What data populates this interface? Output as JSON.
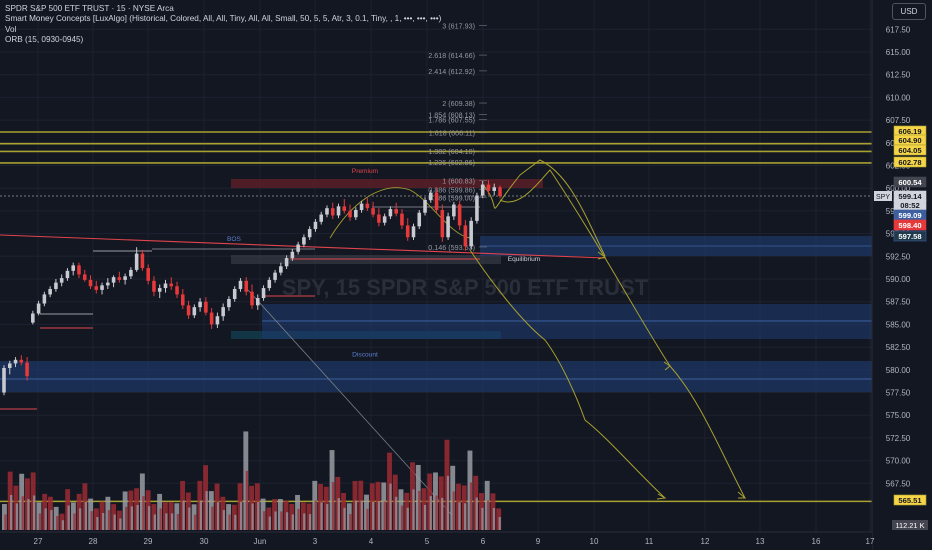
{
  "header": {
    "title": "SPDR S&P 500 ETF TRUST · 15 · NYSE Arca",
    "indicators": [
      "Smart Money Concepts [LuxAlgo] (Historical, Colored, All, All, Tiny, All, All, Small, 50, 5, 5, Atr, 3, 0.1, Tiny, , 1, •••, •••, •••)",
      "Vol",
      "ORB (15, 0930-0945)"
    ],
    "currency_button": "USD"
  },
  "colors": {
    "background": "#131722",
    "grid": "#1e2230",
    "candle_up": "#c8cad1",
    "candle_down": "#e6393a",
    "olive": "#a8a030",
    "zone_blue": "#1e3a6e",
    "red_line": "#e0444c",
    "volume_down": "#9c2a32",
    "volume_up": "#9a9ca2"
  },
  "chart_data": {
    "type": "candlestick",
    "symbol": "SPY",
    "watermark": "SPY, 15 SPDR S&P 500 ETF TRUST",
    "y_axis": {
      "range": [
        565.0,
        619.0
      ],
      "ticks": [
        617.5,
        615.0,
        612.5,
        610.0,
        607.5,
        605.0,
        602.5,
        600.0,
        597.5,
        595.0,
        592.5,
        590.0,
        587.5,
        585.0,
        582.5,
        580.0,
        577.5,
        575.0,
        572.5,
        570.0,
        567.5
      ],
      "tick_labels": [
        "617.50",
        "615.00",
        "612.50",
        "610.00",
        "607.50",
        "605.00",
        "602.50",
        "600.00",
        "597.50",
        "595.00",
        "592.50",
        "590.00",
        "587.50",
        "585.00",
        "582.50",
        "580.00",
        "577.50",
        "575.00",
        "572.50",
        "570.00",
        "567.50"
      ]
    },
    "x_axis": {
      "labels": [
        "27",
        "28",
        "29",
        "30",
        "Jun",
        "3",
        "4",
        "5",
        "6",
        "9",
        "10",
        "11",
        "12",
        "13",
        "16",
        "17"
      ]
    },
    "price_badges": [
      {
        "label": "606.19",
        "value": 606.19,
        "style": "olive"
      },
      {
        "label": "604.90",
        "value": 604.9,
        "style": "olive"
      },
      {
        "label": "604.05",
        "value": 604.05,
        "style": "olive"
      },
      {
        "label": "602.78",
        "value": 602.78,
        "style": "olive"
      },
      {
        "label": "600.54",
        "value": 600.54,
        "style": "grey"
      },
      {
        "label": "599.14",
        "value": 599.14,
        "style": "current"
      },
      {
        "label": "08:52",
        "value": 598.4,
        "style": "time"
      },
      {
        "label": "599.09",
        "value": 597.2,
        "style": "blue"
      },
      {
        "label": "598.40",
        "value": 596.5,
        "style": "red"
      },
      {
        "label": "597.58",
        "value": 595.7,
        "style": "dark"
      },
      {
        "label": "565.51",
        "value": 565.51,
        "style": "olive"
      }
    ],
    "symbol_tag": "SPY",
    "volume_badge": "112.21 K",
    "fib_levels": [
      {
        "label": "3 (617.93)",
        "value": 617.93
      },
      {
        "label": "2.618 (614.66)",
        "value": 614.66
      },
      {
        "label": "2.414 (612.92)",
        "value": 612.92
      },
      {
        "label": "2 (609.38)",
        "value": 609.38
      },
      {
        "label": "1.854 (608.13)",
        "value": 608.13
      },
      {
        "label": "1.786 (607.55)",
        "value": 607.55
      },
      {
        "label": "1.618 (606.11)",
        "value": 606.11
      },
      {
        "label": "1.382 (604.10)",
        "value": 604.1
      },
      {
        "label": "1.236 (602.86)",
        "value": 602.86
      },
      {
        "label": "1 (600.83)",
        "value": 600.83
      },
      {
        "label": "0.886 (599.86)",
        "value": 599.86
      },
      {
        "label": "0.786 (599.00)",
        "value": 599.0
      },
      {
        "label": "0.146 (593.53)",
        "value": 593.53
      }
    ],
    "annotations": [
      {
        "text": "Premium",
        "price": 602.0,
        "color": "#e0444c"
      },
      {
        "text": "Equilibrium",
        "price": 592.3,
        "color": "#d1d4dc"
      },
      {
        "text": "Discount",
        "price": 581.8,
        "color": "#5b7fcf"
      },
      {
        "text": "BOS",
        "price": 594.5,
        "color": "#5b7fcf"
      }
    ],
    "candles": [
      [
        577.5,
        580.5,
        577.2,
        580.2
      ],
      [
        580.2,
        581.0,
        579.5,
        580.7
      ],
      [
        580.7,
        581.4,
        580.3,
        581.1
      ],
      [
        581.1,
        581.6,
        580.5,
        580.8
      ],
      [
        580.8,
        581.4,
        578.8,
        579.3
      ],
      [
        585.2,
        586.5,
        585.0,
        586.2
      ],
      [
        586.2,
        587.6,
        586.0,
        587.3
      ],
      [
        587.3,
        588.6,
        587.0,
        588.3
      ],
      [
        588.3,
        589.2,
        588.0,
        588.9
      ],
      [
        588.9,
        590.0,
        588.6,
        589.6
      ],
      [
        589.6,
        590.5,
        589.2,
        590.1
      ],
      [
        590.1,
        591.2,
        589.8,
        590.9
      ],
      [
        590.9,
        591.8,
        590.4,
        591.5
      ],
      [
        591.5,
        591.8,
        590.1,
        590.5
      ],
      [
        590.5,
        591.0,
        589.7,
        589.9
      ],
      [
        589.9,
        590.4,
        588.9,
        589.2
      ],
      [
        589.2,
        589.8,
        588.4,
        588.8
      ],
      [
        588.8,
        589.6,
        588.3,
        589.3
      ],
      [
        589.3,
        590.1,
        588.9,
        589.6
      ],
      [
        589.6,
        590.4,
        589.1,
        590.2
      ],
      [
        590.2,
        590.8,
        589.6,
        589.9
      ],
      [
        589.9,
        590.6,
        589.4,
        590.3
      ],
      [
        590.3,
        591.3,
        590.0,
        591.0
      ],
      [
        591.0,
        593.5,
        590.8,
        592.8
      ],
      [
        592.8,
        593.2,
        590.9,
        591.2
      ],
      [
        591.2,
        591.6,
        589.4,
        589.8
      ],
      [
        589.8,
        590.3,
        588.1,
        588.6
      ],
      [
        588.6,
        589.4,
        587.9,
        589.0
      ],
      [
        589.0,
        589.9,
        588.5,
        589.5
      ],
      [
        589.5,
        590.2,
        588.8,
        589.2
      ],
      [
        589.2,
        589.7,
        587.9,
        588.3
      ],
      [
        588.3,
        588.9,
        586.7,
        587.1
      ],
      [
        587.1,
        587.6,
        585.6,
        586.0
      ],
      [
        586.0,
        587.2,
        585.7,
        586.9
      ],
      [
        586.9,
        587.9,
        586.4,
        587.5
      ],
      [
        587.5,
        588.0,
        586.0,
        586.3
      ],
      [
        586.3,
        586.8,
        584.5,
        585.0
      ],
      [
        585.0,
        586.3,
        584.6,
        585.9
      ],
      [
        585.9,
        587.3,
        585.4,
        586.9
      ],
      [
        586.9,
        588.1,
        586.5,
        587.8
      ],
      [
        587.8,
        589.2,
        587.5,
        588.9
      ],
      [
        588.9,
        590.1,
        588.6,
        589.8
      ],
      [
        589.8,
        590.2,
        588.2,
        588.6
      ],
      [
        588.6,
        589.4,
        586.7,
        587.1
      ],
      [
        587.1,
        588.3,
        586.6,
        587.9
      ],
      [
        587.9,
        589.3,
        587.6,
        589.0
      ],
      [
        589.0,
        590.2,
        588.7,
        589.9
      ],
      [
        589.9,
        591.0,
        589.6,
        590.7
      ],
      [
        590.7,
        591.8,
        590.4,
        591.4
      ],
      [
        591.4,
        592.6,
        591.1,
        592.3
      ],
      [
        592.3,
        593.3,
        592.0,
        593.0
      ],
      [
        593.0,
        594.1,
        592.7,
        593.8
      ],
      [
        593.8,
        594.9,
        593.5,
        594.6
      ],
      [
        594.6,
        595.8,
        594.3,
        595.5
      ],
      [
        595.5,
        596.6,
        595.2,
        596.3
      ],
      [
        596.3,
        597.4,
        596.0,
        597.1
      ],
      [
        597.1,
        598.1,
        596.8,
        597.8
      ],
      [
        597.8,
        598.4,
        596.6,
        597.0
      ],
      [
        597.0,
        598.3,
        596.7,
        598.0
      ],
      [
        598.0,
        598.8,
        597.2,
        597.5
      ],
      [
        597.5,
        598.2,
        596.4,
        596.8
      ],
      [
        596.8,
        597.9,
        596.5,
        597.6
      ],
      [
        597.6,
        598.6,
        597.3,
        598.3
      ],
      [
        598.3,
        598.9,
        597.5,
        597.8
      ],
      [
        597.8,
        598.5,
        596.8,
        597.1
      ],
      [
        597.1,
        597.8,
        595.8,
        596.2
      ],
      [
        596.2,
        597.2,
        595.9,
        596.9
      ],
      [
        596.9,
        598.0,
        596.6,
        597.7
      ],
      [
        597.7,
        598.4,
        596.9,
        597.2
      ],
      [
        597.2,
        597.7,
        595.5,
        595.9
      ],
      [
        595.9,
        596.7,
        594.2,
        594.6
      ],
      [
        594.6,
        596.1,
        594.3,
        595.8
      ],
      [
        595.8,
        597.6,
        595.5,
        597.3
      ],
      [
        597.3,
        599.0,
        597.0,
        598.7
      ],
      [
        598.7,
        599.8,
        598.4,
        599.5
      ],
      [
        599.5,
        600.0,
        597.2,
        597.6
      ],
      [
        597.6,
        598.2,
        594.1,
        594.6
      ],
      [
        594.6,
        597.3,
        594.3,
        596.9
      ],
      [
        596.9,
        598.5,
        596.5,
        598.2
      ],
      [
        598.2,
        598.6,
        595.4,
        595.9
      ],
      [
        595.9,
        596.5,
        593.1,
        593.6
      ],
      [
        593.6,
        596.8,
        593.3,
        596.4
      ],
      [
        596.4,
        599.5,
        596.1,
        599.2
      ],
      [
        599.2,
        600.8,
        598.9,
        600.4
      ],
      [
        600.4,
        600.9,
        599.3,
        599.7
      ],
      [
        599.7,
        600.5,
        599.2,
        600.1
      ],
      [
        600.1,
        600.3,
        598.9,
        599.14
      ]
    ],
    "volume": [
      0.35,
      0.5,
      0.45,
      0.7,
      0.42,
      0.55,
      0.32,
      0.28,
      0.3,
      0.25,
      0.22,
      0.35,
      0.28,
      0.45,
      0.38,
      0.3,
      0.25,
      0.22,
      0.3,
      0.28,
      0.26,
      0.33,
      0.4,
      0.52,
      0.46,
      0.38,
      0.3,
      0.28,
      0.25,
      0.3,
      0.36,
      0.42,
      0.38,
      0.32,
      0.4,
      0.62,
      0.45,
      0.36,
      0.3,
      0.28,
      0.34,
      0.4,
      1.0,
      0.55,
      0.38,
      0.3,
      0.26,
      0.24,
      0.28,
      0.32,
      0.35,
      0.3,
      0.28,
      0.33,
      0.4,
      0.44,
      0.5,
      0.62,
      0.48,
      0.4,
      0.36,
      0.42,
      0.5,
      0.44,
      0.38,
      0.46,
      0.55,
      0.6,
      0.5,
      0.44,
      0.5,
      0.58,
      0.66,
      0.52,
      0.46,
      0.55,
      0.62,
      0.7,
      0.58,
      0.5,
      0.6,
      0.68,
      0.55,
      0.46,
      0.4,
      0.35,
      0.25
    ],
    "grid": true
  }
}
